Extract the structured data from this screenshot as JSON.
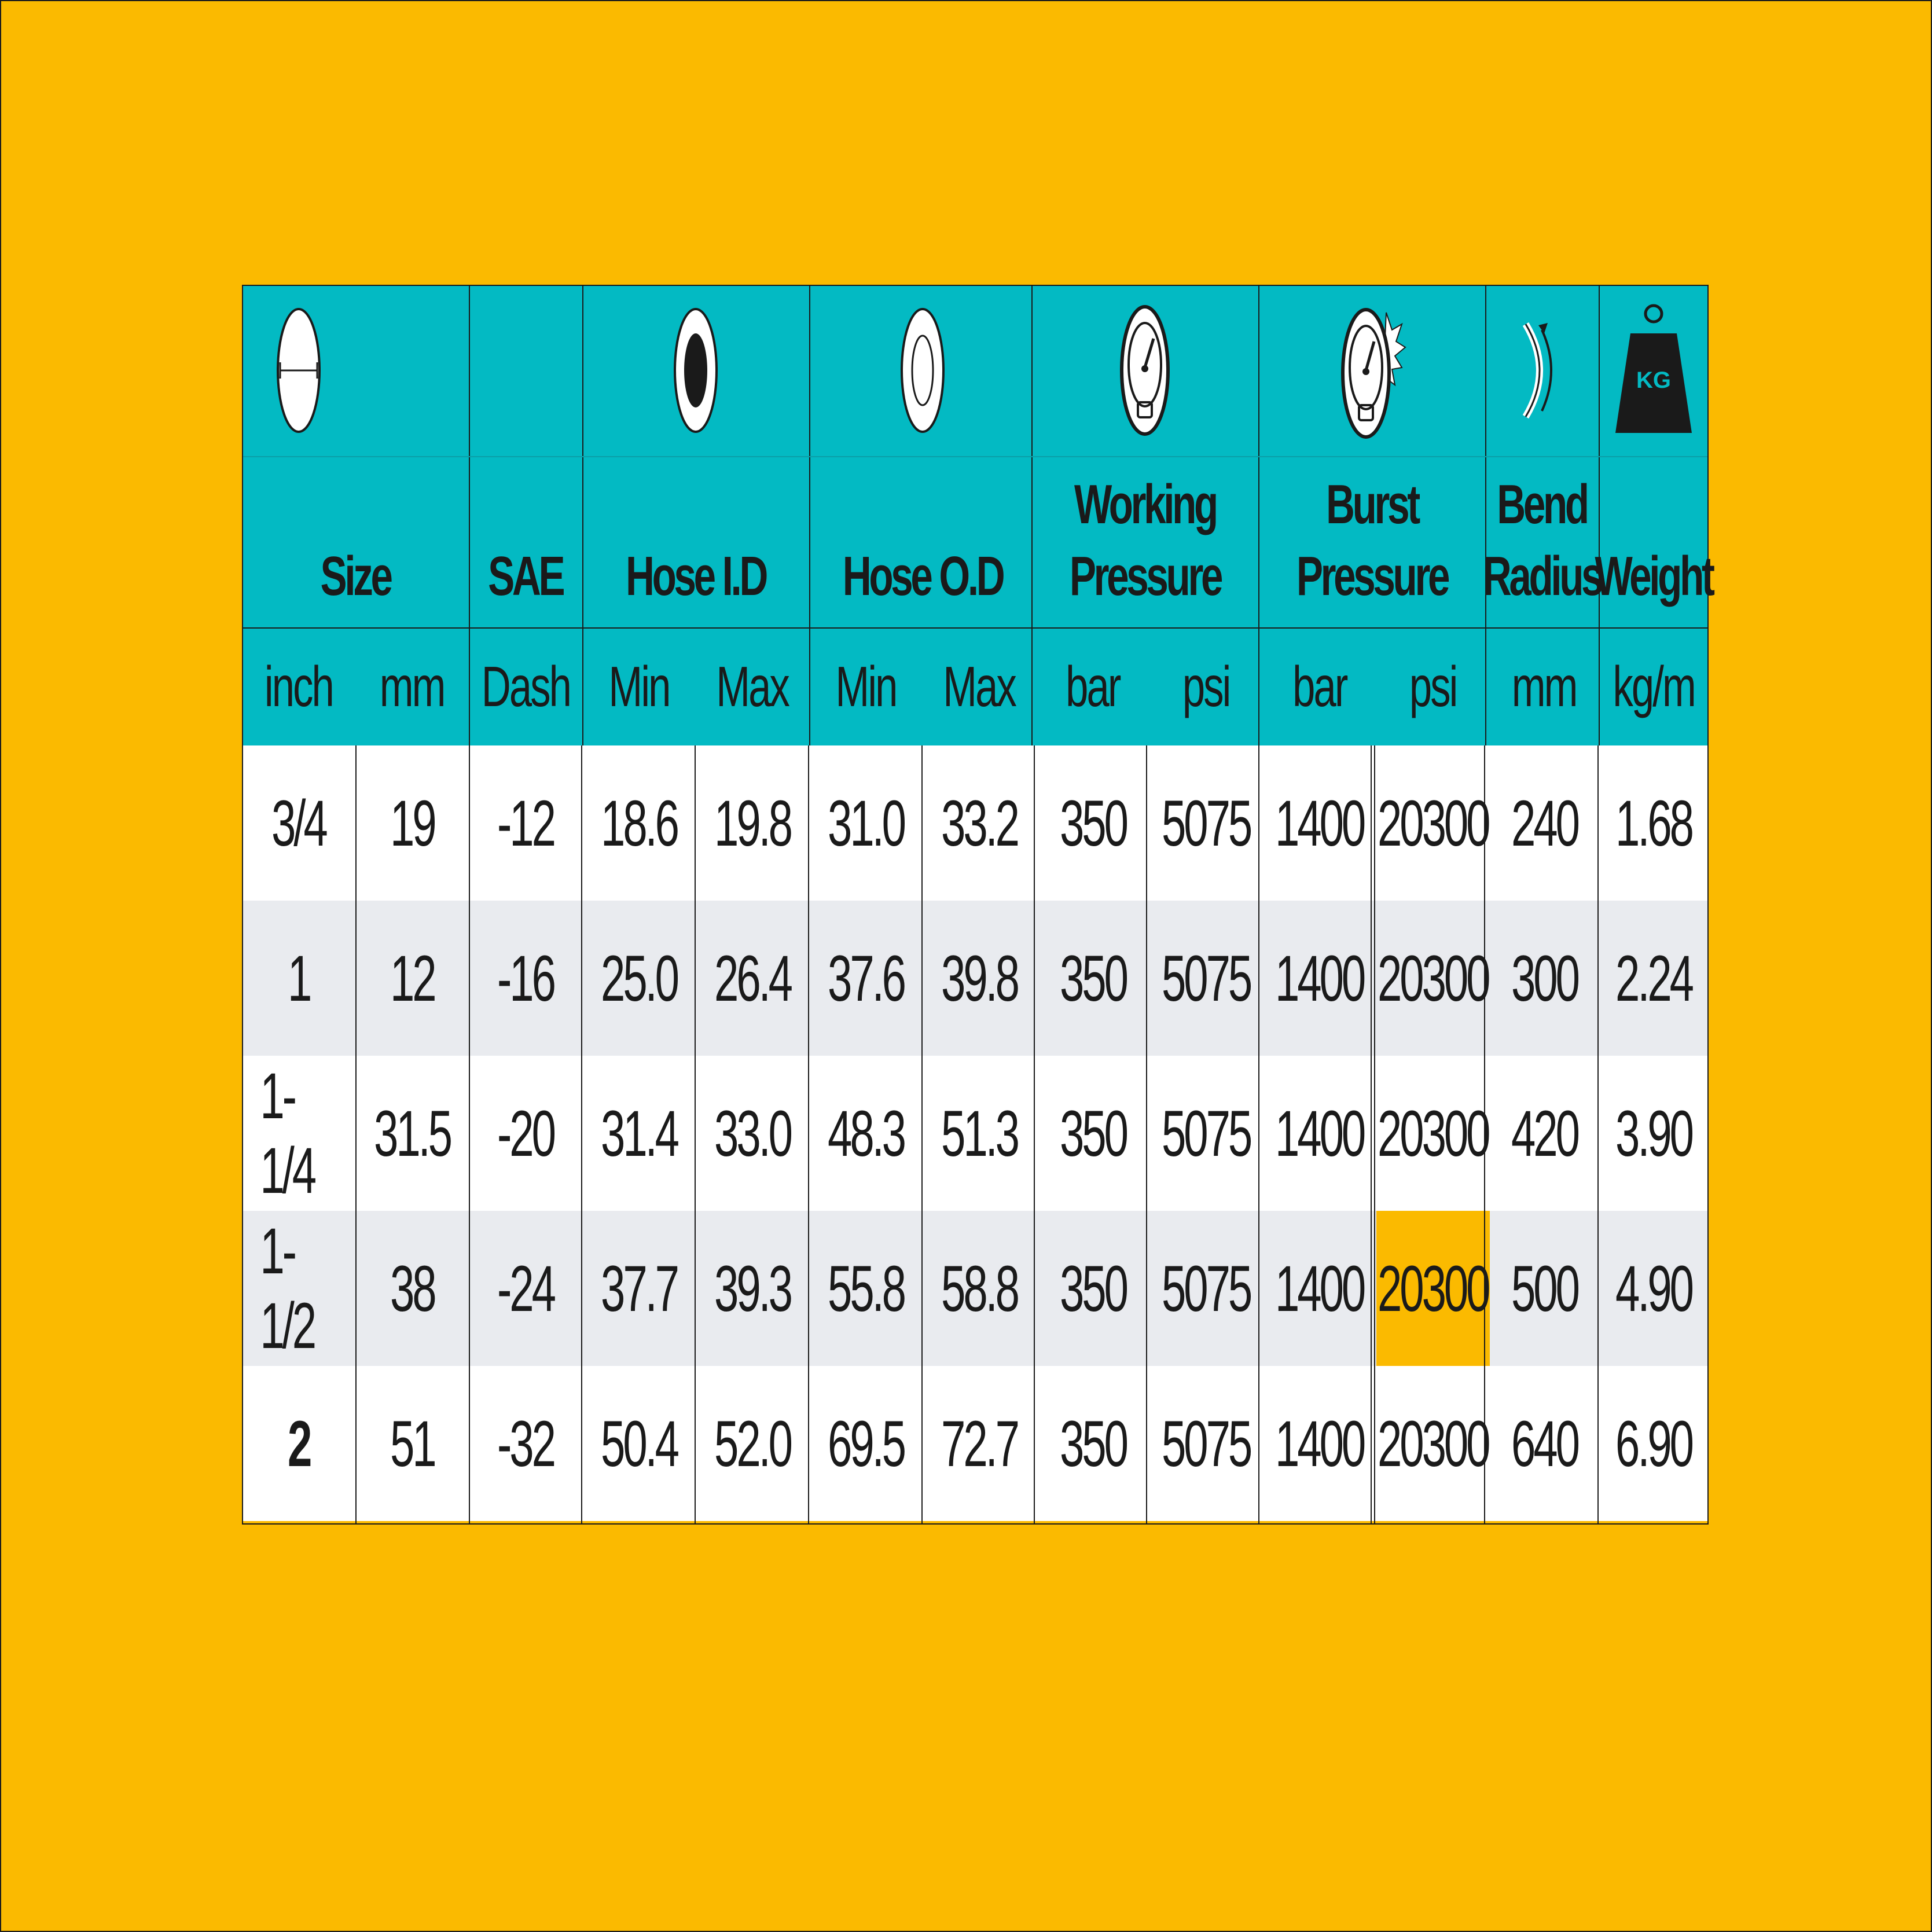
{
  "colors": {
    "background": "#FBBA00",
    "header": "#03BAC3",
    "row_alt": "#E9EBEF",
    "highlight": "#FBBA00",
    "text": "#1a1a1a"
  },
  "header": {
    "groups": [
      {
        "title": "Size",
        "icon": "hose-size-icon"
      },
      {
        "title": "SAE",
        "icon": ""
      },
      {
        "title": "Hose I.D",
        "icon": "hose-inner-diameter-icon"
      },
      {
        "title": "Hose O.D",
        "icon": "hose-outer-diameter-icon"
      },
      {
        "title": "Working\nPressure",
        "icon": "pressure-gauge-icon"
      },
      {
        "title": "Burst\nPressure",
        "icon": "burst-pressure-gauge-icon"
      },
      {
        "title": "Bend\nRadius",
        "icon": "bend-radius-icon"
      },
      {
        "title": "Weight",
        "icon": "kg-weight-icon"
      }
    ],
    "weight_icon_label": "KG",
    "units": [
      "inch",
      "mm",
      "Dash",
      "Min",
      "Max",
      "Min",
      "Max",
      "bar",
      "psi",
      "bar",
      "psi",
      "mm",
      "kg/m"
    ]
  },
  "rows": [
    [
      "3/4",
      "19",
      "-12",
      "18.6",
      "19.8",
      "31.0",
      "33.2",
      "350",
      "5075",
      "1400",
      "20300",
      "240",
      "1.68"
    ],
    [
      "1",
      "12",
      "-16",
      "25.0",
      "26.4",
      "37.6",
      "39.8",
      "350",
      "5075",
      "1400",
      "20300",
      "300",
      "2.24"
    ],
    [
      "1-1/4",
      "31.5",
      "-20",
      "31.4",
      "33.0",
      "48.3",
      "51.3",
      "350",
      "5075",
      "1400",
      "20300",
      "420",
      "3.90"
    ],
    [
      "1-1/2",
      "38",
      "-24",
      "37.7",
      "39.3",
      "55.8",
      "58.8",
      "350",
      "5075",
      "1400",
      "20300",
      "500",
      "4.90"
    ],
    [
      "2",
      "51",
      "-32",
      "50.4",
      "52.0",
      "69.5",
      "72.7",
      "350",
      "5075",
      "1400",
      "20300",
      "640",
      "6.90"
    ]
  ],
  "highlighted_cell": {
    "row": 3,
    "col": 10
  }
}
